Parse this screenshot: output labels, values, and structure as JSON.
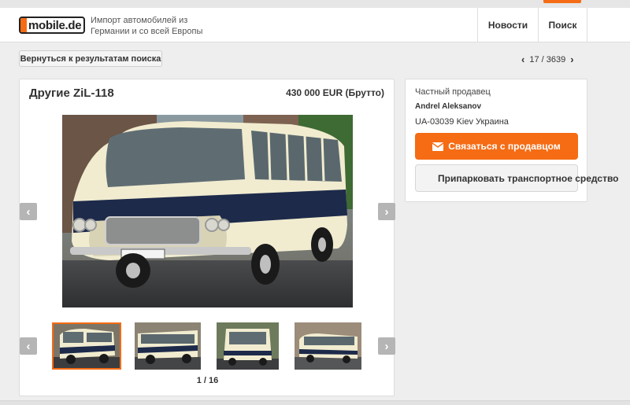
{
  "header": {
    "logo_text": "mobile.de",
    "tagline": "Импорт автомобилей из Германии и со всей Европы",
    "nav": [
      {
        "label": "Новости"
      },
      {
        "label": "Поиск"
      }
    ]
  },
  "toolbar": {
    "back_label": "Вернуться к результатам поиска",
    "pager_text": "17 / 3639"
  },
  "listing": {
    "title": "Другие ZiL-118",
    "price": "430 000 EUR (Брутто)",
    "photo_counter": "1 / 16"
  },
  "seller": {
    "type": "Частный продавец",
    "name": "Andrel Aleksanov",
    "location": "UA-03039 Kiev Украина",
    "contact_label": "Связаться с продавцом",
    "park_label": "Припарковать транспортное средство"
  },
  "icons": {
    "envelope": "envelope-icon",
    "park": "parking-icon",
    "prev": "chevron-left-icon",
    "next": "chevron-right-icon"
  },
  "colors": {
    "accent": "#f56c14",
    "bus_body": "#f1ecd0",
    "bus_stripe": "#1d2a4a"
  }
}
